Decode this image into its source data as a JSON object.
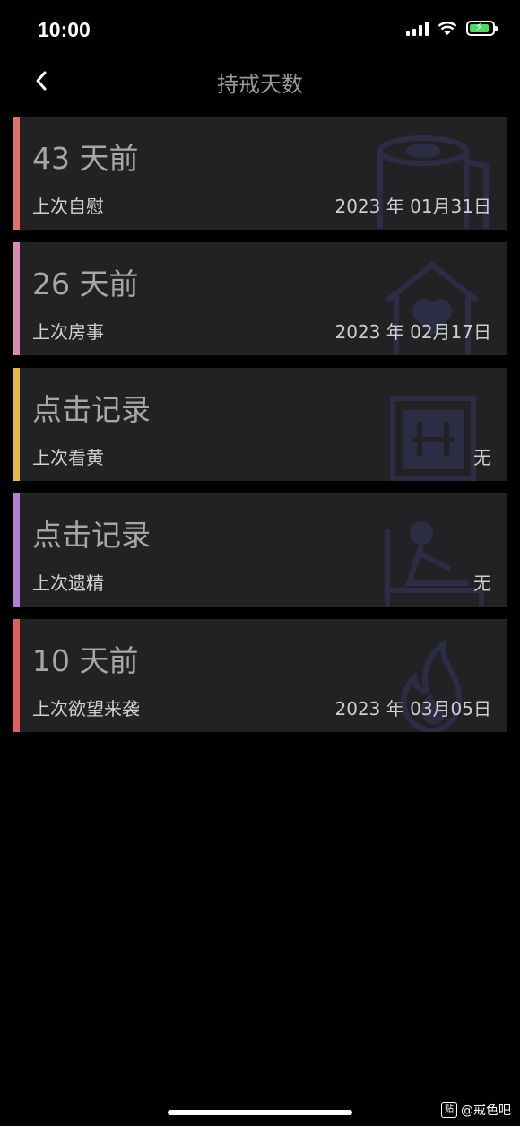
{
  "status_bar": {
    "time": "10:00"
  },
  "nav": {
    "title": "持戒天数"
  },
  "cards": [
    {
      "headline": "43 天前",
      "label": "上次自慰",
      "value": "2023 年 01月31日",
      "accent": "#e07368",
      "icon": "toilet-paper-icon"
    },
    {
      "headline": "26 天前",
      "label": "上次房事",
      "value": "2023 年 02月17日",
      "accent": "#d98bb7",
      "icon": "house-heart-icon"
    },
    {
      "headline": "点击记录",
      "label": "上次看黄",
      "value": "无",
      "accent": "#e6b84a",
      "icon": "adult-sign-icon"
    },
    {
      "headline": "点击记录",
      "label": "上次遗精",
      "value": "无",
      "accent": "#b67fd6",
      "icon": "person-bed-icon"
    },
    {
      "headline": "10 天前",
      "label": "上次欲望来袭",
      "value": "2023 年 03月05日",
      "accent": "#e06060",
      "icon": "flame-icon"
    }
  ],
  "watermark": {
    "text": "@戒色吧",
    "logo_text": "贴"
  }
}
